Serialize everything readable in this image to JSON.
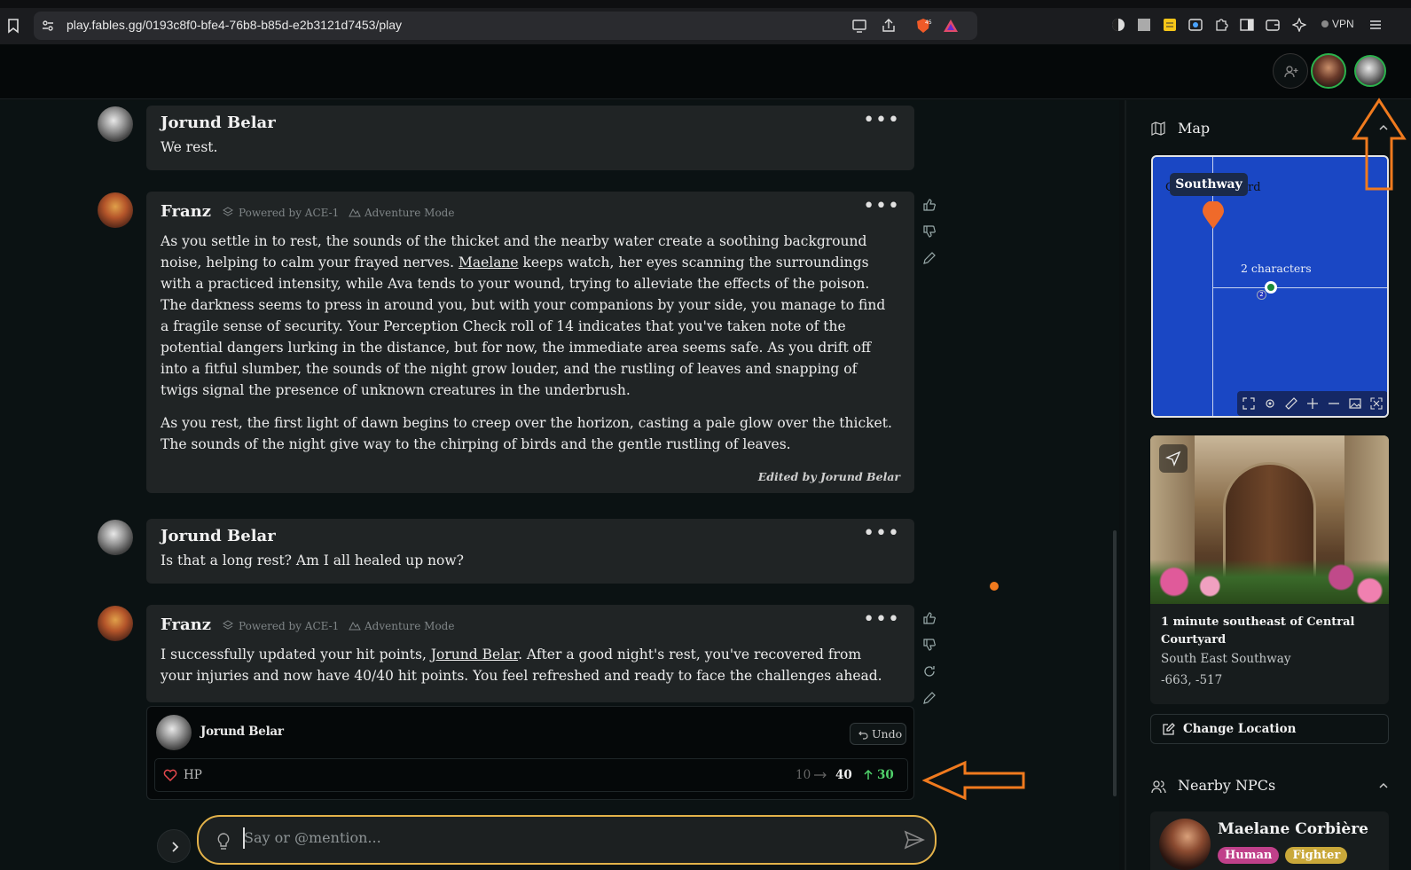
{
  "browser": {
    "url": "play.fables.gg/0193c8f0-bfe4-76b8-b85d-e2b3121d7453/play",
    "vpn": "VPN",
    "badge_count": "45"
  },
  "messages": [
    {
      "author": "Jorund Belar",
      "text": "We rest."
    },
    {
      "author": "Franz",
      "powered": "Powered by ACE-1",
      "mode": "Adventure Mode",
      "p1_a": "As you settle in to rest, the sounds of the thicket and the nearby water create a soothing background noise, helping to calm your frayed nerves. ",
      "p1_link": "Maelane",
      "p1_b": " keeps watch, her eyes scanning the surroundings with a practiced intensity, while Ava tends to your wound, trying to alleviate the effects of the poison. The darkness seems to press in around you, but with your companions by your side, you manage to find a fragile sense of security. Your Perception Check roll of 14 indicates that you've taken note of the potential dangers lurking in the distance, but for now, the immediate area seems safe. As you drift off into a fitful slumber, the sounds of the night grow louder, and the rustling of leaves and snapping of twigs signal the presence of unknown creatures in the underbrush.",
      "p2": "As you rest, the first light of dawn begins to creep over the horizon, casting a pale glow over the thicket. The sounds of the night give way to the chirping of birds and the gentle rustling of leaves.",
      "edited": "Edited by Jorund Belar"
    },
    {
      "author": "Jorund Belar",
      "text": "Is that a long rest? Am I all healed up now?"
    },
    {
      "author": "Franz",
      "powered": "Powered by ACE-1",
      "mode": "Adventure Mode",
      "t_a": "I successfully updated your hit points, ",
      "t_link": "Jorund Belar",
      "t_b": ". After a good night's rest, you've recovered from your injuries and now have 40/40 hit points. You feel refreshed and ready to face the challenges ahead."
    }
  ],
  "update": {
    "name": "Jorund Belar",
    "undo": "Undo",
    "stat": "HP",
    "from": "10",
    "to": "40",
    "delta": "30"
  },
  "input": {
    "placeholder": "Say or @mention..."
  },
  "map": {
    "title": "Map",
    "label": "Southway",
    "behind_left": "C",
    "behind_right": "rd",
    "characters": "2 characters",
    "marker_count": "2"
  },
  "location": {
    "title": "1 minute southeast of Central Courtyard",
    "region": "South East Southway",
    "coords": "-663, -517",
    "change": "Change Location"
  },
  "npcs": {
    "title": "Nearby NPCs",
    "items": [
      {
        "name": "Maelane Corbière",
        "race": "Human",
        "class": "Fighter"
      }
    ]
  },
  "colors": {
    "accent": "#e3b24a",
    "annotation": "#f07a1e",
    "hp_up": "#4fd16a",
    "map_bg": "#1a47c4"
  }
}
